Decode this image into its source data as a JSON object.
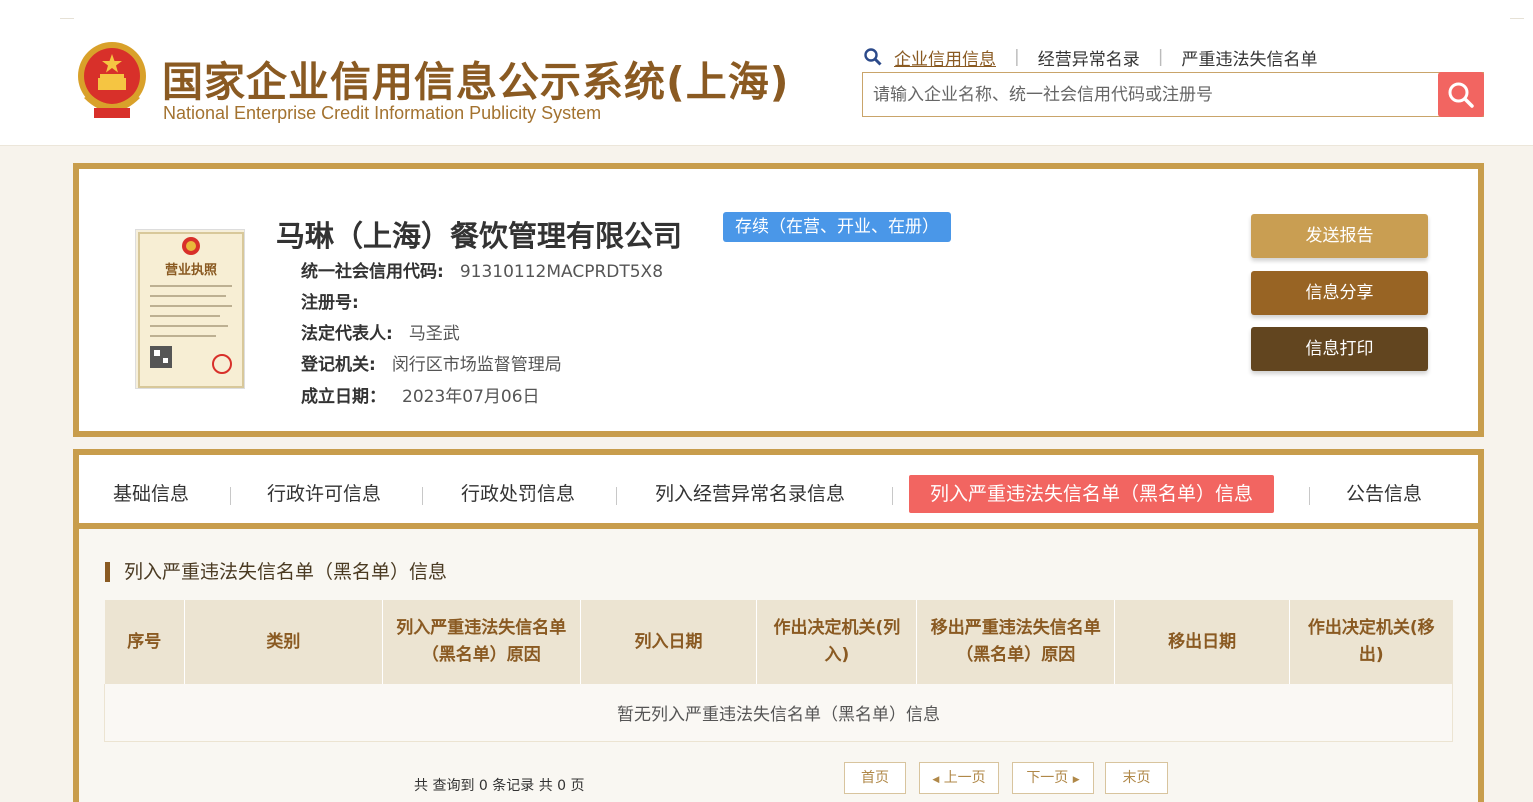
{
  "header": {
    "title": "国家企业信用信息公示系统(上海)",
    "subtitle": "National Enterprise Credit Information Publicity System",
    "nav": [
      "企业信用信息",
      "经营异常名录",
      "严重违法失信名单"
    ],
    "search_placeholder": "请输入企业名称、统一社会信用代码或注册号"
  },
  "company": {
    "name": "马琳（上海）餐饮管理有限公司",
    "status": "存续（在营、开业、在册）",
    "license_title": "营业执照",
    "fields": [
      {
        "label": "统一社会信用代码:",
        "value": "91310112MACPRDT5X8"
      },
      {
        "label": "注册号:",
        "value": ""
      },
      {
        "label": "法定代表人:",
        "value": "马圣武"
      },
      {
        "label": "登记机关:",
        "value": "闵行区市场监督管理局"
      },
      {
        "label": "成立日期：",
        "value": "2023年07月06日"
      }
    ],
    "actions": [
      "发送报告",
      "信息分享",
      "信息打印"
    ]
  },
  "tabs": [
    "基础信息",
    "行政许可信息",
    "行政处罚信息",
    "列入经营异常名录信息",
    "列入严重违法失信名单（黑名单）信息",
    "公告信息"
  ],
  "section": {
    "title": "列入严重违法失信名单（黑名单）信息",
    "columns": [
      "序号",
      "类别",
      "列入严重违法失信名单（黑名单）原因",
      "列入日期",
      "作出决定机关(列入)",
      "移出严重违法失信名单（黑名单）原因",
      "移出日期",
      "作出决定机关(移出)"
    ],
    "empty_text": "暂无列入严重违法失信名单（黑名单）信息"
  },
  "pagination": {
    "summary": "共 查询到 0 条记录 共 0 页",
    "first": "首页",
    "prev": "上一页",
    "next": "下一页",
    "last": "末页"
  },
  "colors": {
    "brand_gold": "#c89d4c",
    "brand_brown": "#8a5a22",
    "accent_red": "#f26561",
    "status_blue": "#4a97e8"
  }
}
